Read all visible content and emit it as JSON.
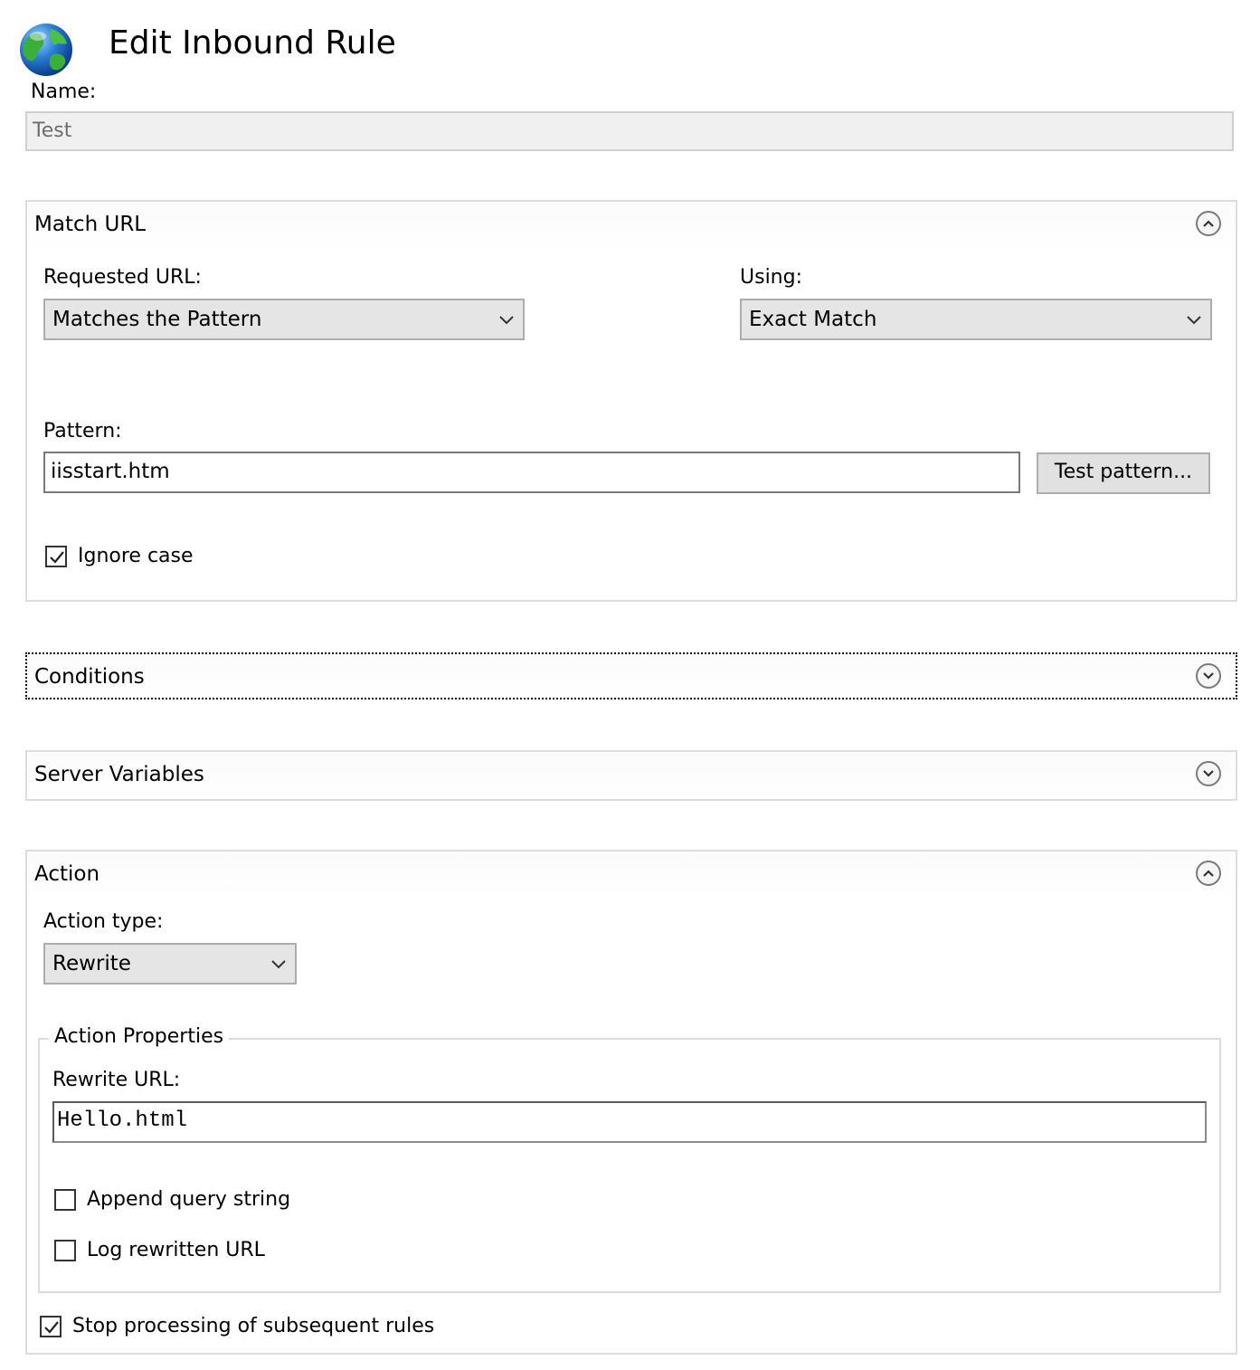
{
  "header": {
    "title": "Edit Inbound Rule",
    "icon": "globe-icon"
  },
  "name": {
    "label": "Name:",
    "value": "Test"
  },
  "match_url": {
    "title": "Match URL",
    "toggle_state": "expanded",
    "requested_url_label": "Requested URL:",
    "requested_url_value": "Matches the Pattern",
    "using_label": "Using:",
    "using_value": "Exact Match",
    "pattern_label": "Pattern:",
    "pattern_value": "iisstart.htm",
    "test_pattern_button": "Test pattern...",
    "ignore_case_label": "Ignore case",
    "ignore_case_checked": true
  },
  "conditions": {
    "title": "Conditions",
    "toggle_state": "collapsed"
  },
  "server_variables": {
    "title": "Server Variables",
    "toggle_state": "collapsed"
  },
  "action": {
    "title": "Action",
    "toggle_state": "expanded",
    "action_type_label": "Action type:",
    "action_type_value": "Rewrite",
    "properties_legend": "Action Properties",
    "rewrite_url_label": "Rewrite URL:",
    "rewrite_url_value": "Hello.html",
    "append_query_label": "Append query string",
    "append_query_checked": false,
    "log_rewritten_label": "Log rewritten URL",
    "log_rewritten_checked": false,
    "stop_processing_label": "Stop processing of subsequent rules",
    "stop_processing_checked": true
  }
}
